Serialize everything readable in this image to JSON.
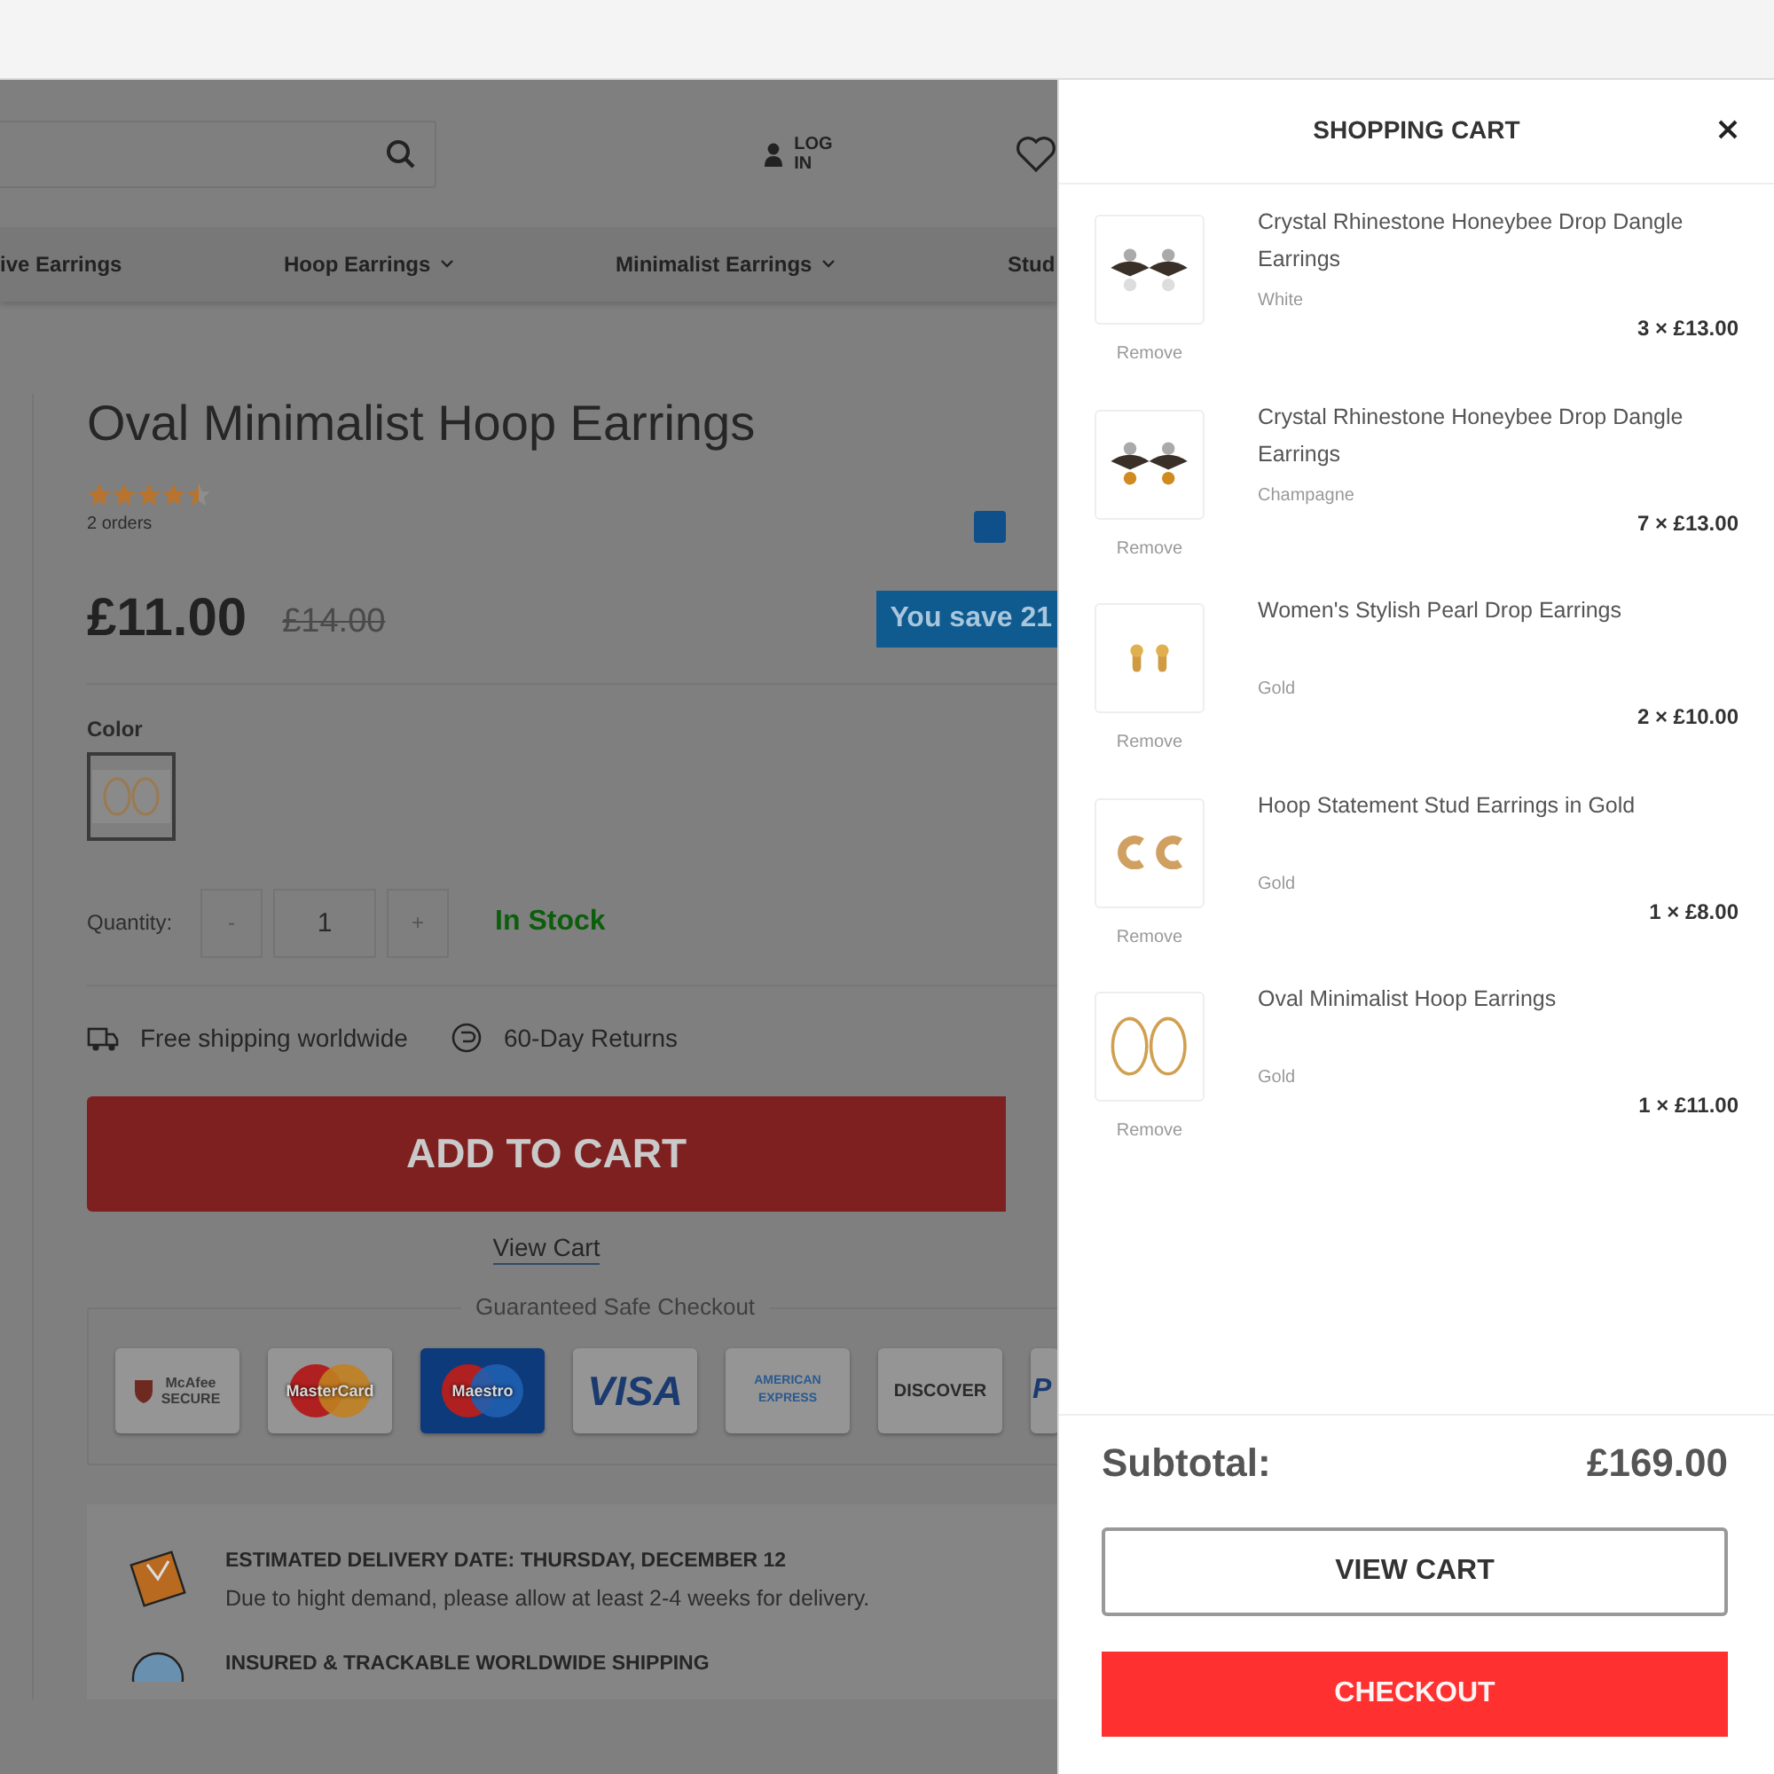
{
  "header": {
    "login": "LOG IN"
  },
  "nav": [
    {
      "label": "ive Earrings",
      "dropdown": false
    },
    {
      "label": "Hoop Earrings",
      "dropdown": true
    },
    {
      "label": "Minimalist Earrings",
      "dropdown": true
    },
    {
      "label": "Stud",
      "dropdown": false
    }
  ],
  "product": {
    "title": "Oval Minimalist Hoop Earrings",
    "stars": 4.5,
    "orders": "2 orders",
    "price": "£11.00",
    "old_price": "£14.00",
    "savings": "You save 21",
    "color_label": "Color",
    "swatches": [
      {
        "kind": "picture",
        "selected": true
      }
    ],
    "quantity_label": "Quantity:",
    "minus": "-",
    "quantity": "1",
    "plus": "+",
    "stock": "In Stock",
    "features": [
      {
        "kind": "shipping",
        "text": "Free shipping worldwide"
      },
      {
        "kind": "returns",
        "text": "60-Day Returns"
      }
    ],
    "add_button": "ADD TO CART",
    "view_cart_link": "View Cart"
  },
  "checkout": {
    "title": "Guaranteed Safe Checkout",
    "badges": [
      {
        "kind": "mcafee",
        "text": "McAfee SECURE"
      },
      {
        "kind": "mastercard",
        "text": "MasterCard"
      },
      {
        "kind": "maestro",
        "text": "Maestro"
      },
      {
        "kind": "visa",
        "text": "VISA"
      },
      {
        "kind": "amex",
        "text": "AMERICAN EXPRESS"
      },
      {
        "kind": "discover",
        "text": "DISCOVER"
      },
      {
        "kind": "paypal",
        "text": "P"
      }
    ]
  },
  "delivery": [
    {
      "kind": "box",
      "heading": "ESTIMATED DELIVERY DATE: THURSDAY, DECEMBER 12",
      "text": "Due to hight demand, please allow at least 2-4 weeks for delivery."
    },
    {
      "kind": "globe",
      "heading": "INSURED & TRACKABLE WORLDWIDE SHIPPING"
    }
  ],
  "cart": {
    "title": "SHOPPING CART",
    "items": [
      {
        "name": "Crystal Rhinestone Honeybee Drop Dangle Earrings",
        "variant": "White",
        "remove": "Remove",
        "qty_price": "3 × £13.00"
      },
      {
        "name": "Crystal Rhinestone Honeybee Drop Dangle Earrings",
        "variant": "Champagne",
        "remove": "Remove",
        "qty_price": "7 × £13.00"
      },
      {
        "name": "Women's Stylish Pearl Drop Earrings",
        "variant": "Gold",
        "remove": "Remove",
        "qty_price": "2 × £10.00"
      },
      {
        "name": "Hoop Statement Stud Earrings in Gold",
        "variant": "Gold",
        "remove": "Remove",
        "qty_price": "1 × £8.00"
      },
      {
        "name": "Oval Minimalist Hoop Earrings",
        "variant": "Gold",
        "remove": "Remove",
        "qty_price": "1 × £11.00"
      }
    ],
    "subtotal_label": "Subtotal:",
    "subtotal": "£169.00",
    "view_cart": "VIEW CART",
    "checkout": "CHECKOUT"
  }
}
